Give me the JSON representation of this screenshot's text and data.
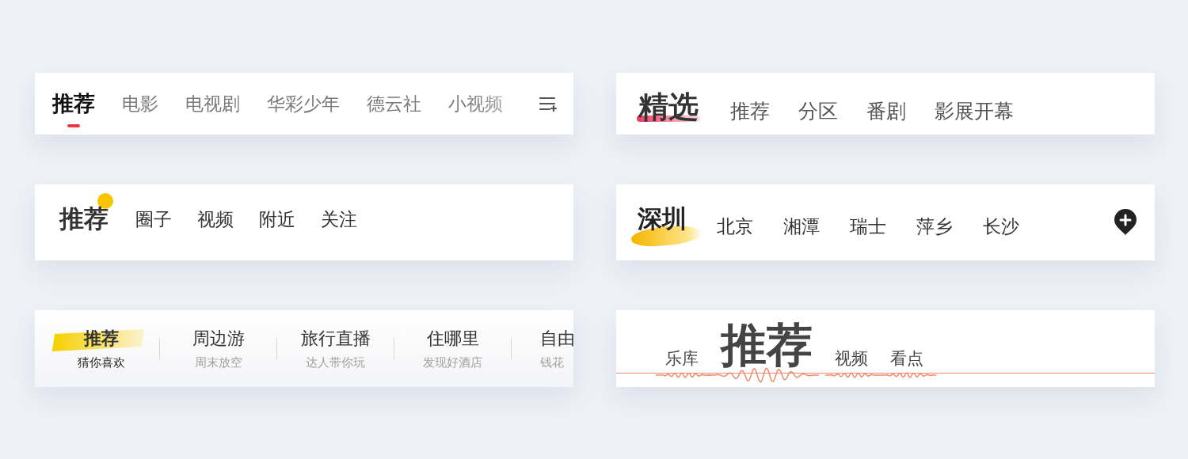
{
  "bars": [
    {
      "kind": "underline",
      "trailing_action": {
        "kind": "menu"
      },
      "tabs": [
        {
          "label": "推荐",
          "selected": true
        },
        {
          "label": "电影",
          "selected": false
        },
        {
          "label": "电视剧",
          "selected": false
        },
        {
          "label": "华彩少年",
          "selected": false
        },
        {
          "label": "德云社",
          "selected": false
        },
        {
          "label": "小视频",
          "selected": false
        }
      ]
    },
    {
      "kind": "stroke",
      "tabs": [
        {
          "label": "精选",
          "selected": true
        },
        {
          "label": "推荐",
          "selected": false
        },
        {
          "label": "分区",
          "selected": false
        },
        {
          "label": "番剧",
          "selected": false
        },
        {
          "label": "影展开幕",
          "selected": false
        }
      ]
    },
    {
      "kind": "dot",
      "tabs": [
        {
          "label": "推荐",
          "selected": true
        },
        {
          "label": "圈子",
          "selected": false
        },
        {
          "label": "视频",
          "selected": false
        },
        {
          "label": "附近",
          "selected": false
        },
        {
          "label": "关注",
          "selected": false
        }
      ]
    },
    {
      "kind": "brush",
      "trailing_action": {
        "kind": "add-pin"
      },
      "tabs": [
        {
          "label": "深圳",
          "selected": true
        },
        {
          "label": "北京",
          "selected": false
        },
        {
          "label": "湘潭",
          "selected": false
        },
        {
          "label": "瑞士",
          "selected": false
        },
        {
          "label": "萍乡",
          "selected": false
        },
        {
          "label": "长沙",
          "selected": false
        }
      ]
    },
    {
      "kind": "subtitle",
      "tabs": [
        {
          "label": "推荐",
          "subtitle": "猜你喜欢",
          "selected": true
        },
        {
          "label": "周边游",
          "subtitle": "周末放空",
          "selected": false
        },
        {
          "label": "旅行直播",
          "subtitle": "达人带你玩",
          "selected": false
        },
        {
          "label": "住哪里",
          "subtitle": "发现好酒店",
          "selected": false
        },
        {
          "label": "自由",
          "subtitle": "钱花",
          "selected": false
        }
      ]
    },
    {
      "kind": "wave",
      "tabs": [
        {
          "label": "乐库",
          "selected": false
        },
        {
          "label": "推荐",
          "selected": true
        },
        {
          "label": "视频",
          "selected": false
        },
        {
          "label": "看点",
          "selected": false
        }
      ]
    }
  ]
}
